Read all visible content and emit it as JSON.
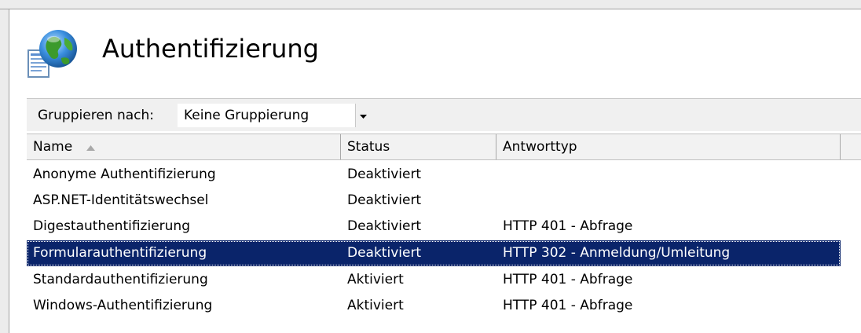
{
  "page": {
    "title": "Authentifizierung",
    "icon": "authentication-globe-document-icon"
  },
  "groupbar": {
    "label": "Gruppieren nach:",
    "selected_value": "Keine Gruppierung",
    "dropdown_icon": "chevron-down-icon"
  },
  "list": {
    "columns": [
      "Name",
      "Status",
      "Antworttyp"
    ],
    "sort_column": "Name",
    "sort_direction": "ascending",
    "rows": [
      {
        "name": "Anonyme Authentifizierung",
        "status": "Deaktiviert",
        "antworttyp": ""
      },
      {
        "name": "ASP.NET-Identitätswechsel",
        "status": "Deaktiviert",
        "antworttyp": ""
      },
      {
        "name": "Digestauthentifizierung",
        "status": "Deaktiviert",
        "antworttyp": "HTTP 401 - Abfrage"
      },
      {
        "name": "Formularauthentifizierung",
        "status": "Deaktiviert",
        "antworttyp": "HTTP 302 - Anmeldung/Umleitung",
        "selected": true
      },
      {
        "name": "Standardauthentifizierung",
        "status": "Aktiviert",
        "antworttyp": "HTTP 401 - Abfrage"
      },
      {
        "name": "Windows-Authentifizierung",
        "status": "Aktiviert",
        "antworttyp": "HTTP 401 - Abfrage"
      }
    ]
  },
  "colors": {
    "selection_background": "#0a246a",
    "selection_text": "#ffffff",
    "header_background": "#f2f2f2",
    "toolbar_background": "#f0f0f0"
  }
}
